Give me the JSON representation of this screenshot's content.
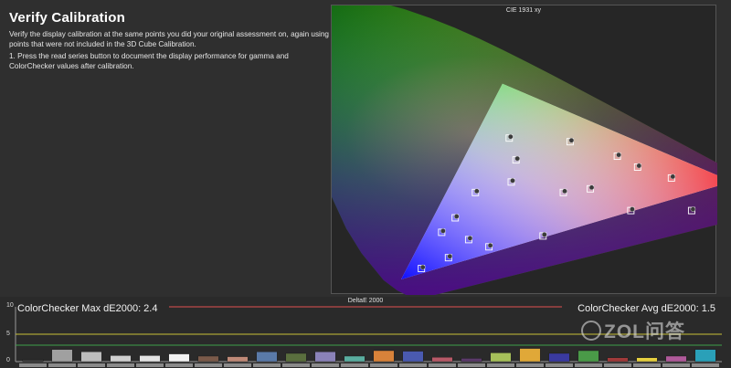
{
  "page": {
    "title": "Verify Calibration",
    "paragraph1": "Verify the display calibration at the same points you did your original assessment on, again using points that were not included in the 3D Cube Calibration.",
    "paragraph2": "1. Press the read series button to document the display performance for gamma and ColorChecker values after calibration."
  },
  "cie": {
    "title": "CIE 1931 xy"
  },
  "deltae": {
    "title": "DeltaE 2000",
    "max_label": "ColorChecker Max dE2000: 2.4",
    "avg_label": "ColorChecker Avg dE2000: 1.5",
    "yticks": [
      "10",
      "5",
      "0"
    ],
    "ref_lines": [
      {
        "value": 5,
        "color": "#c8c038"
      },
      {
        "value": 3,
        "color": "#3fa04a"
      }
    ],
    "top_line_color": "#e05050"
  },
  "watermark": {
    "text": "ZOL问答"
  },
  "chart_data": [
    {
      "type": "scatter",
      "title": "CIE 1931 xy",
      "gamut_triangle": [
        [
          0.64,
          0.33
        ],
        [
          0.3,
          0.6
        ],
        [
          0.15,
          0.06
        ]
      ],
      "points": [
        {
          "x": 0.31,
          "y": 0.45
        },
        {
          "x": 0.4,
          "y": 0.44
        },
        {
          "x": 0.47,
          "y": 0.4
        },
        {
          "x": 0.5,
          "y": 0.37
        },
        {
          "x": 0.55,
          "y": 0.34
        },
        {
          "x": 0.32,
          "y": 0.39
        },
        {
          "x": 0.26,
          "y": 0.3
        },
        {
          "x": 0.39,
          "y": 0.3
        },
        {
          "x": 0.43,
          "y": 0.31
        },
        {
          "x": 0.313,
          "y": 0.329
        },
        {
          "x": 0.49,
          "y": 0.25
        },
        {
          "x": 0.58,
          "y": 0.25
        },
        {
          "x": 0.23,
          "y": 0.23
        },
        {
          "x": 0.21,
          "y": 0.19
        },
        {
          "x": 0.28,
          "y": 0.15
        },
        {
          "x": 0.36,
          "y": 0.18
        },
        {
          "x": 0.22,
          "y": 0.12
        },
        {
          "x": 0.18,
          "y": 0.09
        },
        {
          "x": 0.25,
          "y": 0.17
        }
      ]
    },
    {
      "type": "bar",
      "title": "DeltaE 2000",
      "ylim": [
        0,
        10
      ],
      "values": [
        0.4,
        2.2,
        1.8,
        1.1,
        1.1,
        1.4,
        1.0,
        0.9,
        1.8,
        1.5,
        1.8,
        1.0,
        2.0,
        1.9,
        0.8,
        0.6,
        1.6,
        2.4,
        1.5,
        2.0,
        0.7,
        0.7,
        1.0,
        2.2
      ],
      "colors": [
        "#3a3a3a",
        "#a0a0a0",
        "#bdbdbd",
        "#d0d0d0",
        "#e4e4e4",
        "#f2f2f2",
        "#7a5a4a",
        "#c08a78",
        "#5a7aa8",
        "#5a6e3e",
        "#8a82b8",
        "#5aaea0",
        "#d8823a",
        "#4a5ab0",
        "#b85a68",
        "#5a3a6a",
        "#a6c05a",
        "#e0a838",
        "#3a3aa0",
        "#4a9a48",
        "#a03a3a",
        "#e6d040",
        "#b05a9a",
        "#2aa0b8"
      ]
    }
  ]
}
